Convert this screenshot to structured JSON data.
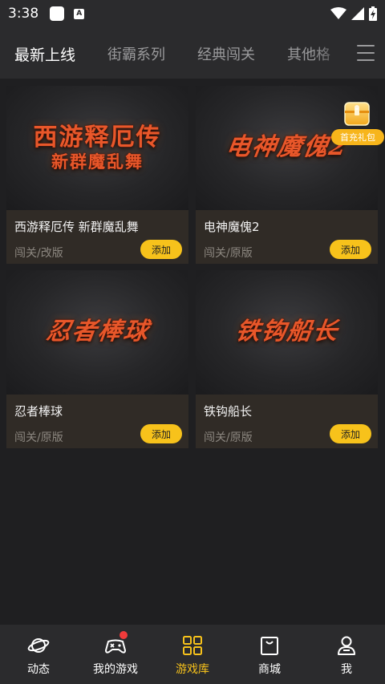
{
  "status": {
    "time": "3:38",
    "a_label": "A"
  },
  "tabs": [
    {
      "label": "最新上线"
    },
    {
      "label": "街霸系列"
    },
    {
      "label": "经典闯关"
    },
    {
      "label": "其他格"
    }
  ],
  "games": [
    {
      "cover_line1": "西游释厄传",
      "cover_line2": "新群魔乱舞",
      "title": "西游释厄传 新群魔乱舞",
      "tags": "闯关/改版",
      "add_label": "添加"
    },
    {
      "cover_line1": "电神魔傀2",
      "title": "电神魔傀2",
      "tags": "闯关/原版",
      "add_label": "添加"
    },
    {
      "cover_line1": "忍者棒球",
      "title": "忍者棒球",
      "tags": "闯关/原版",
      "add_label": "添加"
    },
    {
      "cover_line1": "铁钩船长",
      "title": "铁钩船长",
      "tags": "闯关/原版",
      "add_label": "添加"
    }
  ],
  "gift": {
    "label": "首充礼包"
  },
  "nav": [
    {
      "label": "动态",
      "icon": "planet-icon"
    },
    {
      "label": "我的游戏",
      "icon": "gamepad-icon"
    },
    {
      "label": "游戏库",
      "icon": "grid-icon"
    },
    {
      "label": "商城",
      "icon": "shop-icon"
    },
    {
      "label": "我",
      "icon": "profile-icon"
    }
  ],
  "colors": {
    "accent": "#f7c21b",
    "cover_text": "#e8572a",
    "badge": "#f03b3b"
  }
}
